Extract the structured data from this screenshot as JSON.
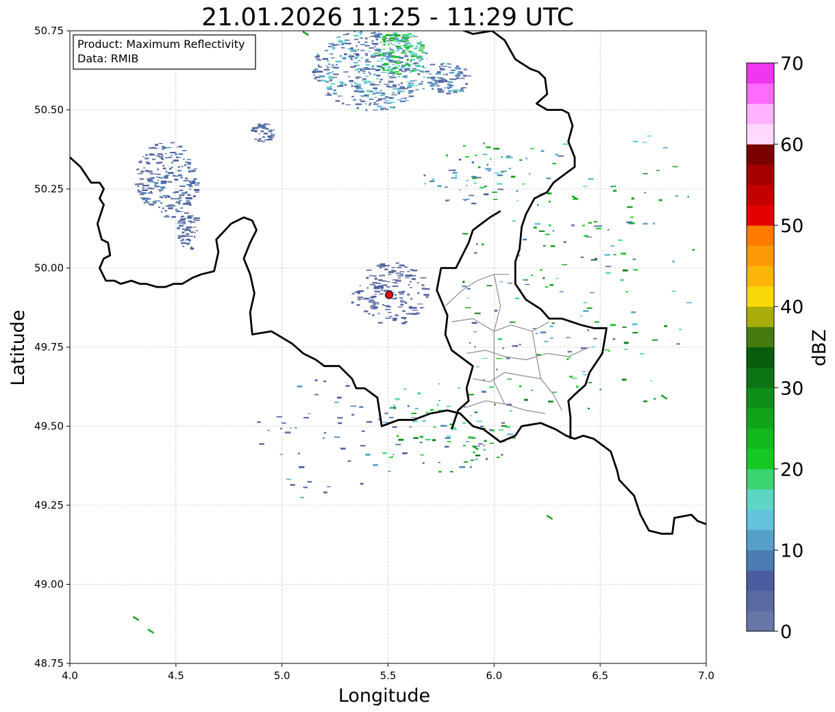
{
  "title": "21.01.2026 11:25 - 11:29 UTC",
  "info_box": {
    "product_line": "Product: Maximum Reflectivity",
    "data_line": "Data: RMIB"
  },
  "axes": {
    "xlabel": "Longitude",
    "ylabel": "Latitude",
    "xlim": [
      4.0,
      7.0
    ],
    "ylim": [
      48.75,
      50.75
    ],
    "xticks": [
      "4.0",
      "4.5",
      "5.0",
      "5.5",
      "6.0",
      "6.5",
      "7.0"
    ],
    "yticks": [
      "48.75",
      "49.00",
      "49.25",
      "49.50",
      "49.75",
      "50.00",
      "50.25",
      "50.50",
      "50.75"
    ],
    "grid": true
  },
  "colorbar": {
    "label": "dBZ",
    "range": [
      0,
      70
    ],
    "ticks": [
      "0",
      "10",
      "20",
      "30",
      "40",
      "50",
      "60",
      "70"
    ],
    "colors": [
      "#6877a8",
      "#5969a2",
      "#4a5da0",
      "#4a7bb2",
      "#55a0c8",
      "#63c2dc",
      "#5ed6c4",
      "#3ad471",
      "#14c922",
      "#13b81c",
      "#11a41a",
      "#0f8e17",
      "#0c7414",
      "#075c0e",
      "#477a0e",
      "#a9ad0c",
      "#fbd808",
      "#fcb609",
      "#fd9a09",
      "#ff7c03",
      "#e50000",
      "#c40000",
      "#a50000",
      "#7a0000",
      "#ffd9fd",
      "#ffb2fd",
      "#ff6bfb",
      "#f036ef"
    ]
  },
  "radar_site": {
    "lon": 5.505,
    "lat": 49.915,
    "color": "#e01010"
  },
  "chart_data": {
    "type": "map",
    "title": "21.01.2026 11:25 - 11:29 UTC",
    "xlabel": "Longitude",
    "ylabel": "Latitude",
    "xlim": [
      4.0,
      7.0
    ],
    "ylim": [
      48.75,
      50.75
    ],
    "grid": true,
    "borders": [
      [
        [
          4.0,
          50.35
        ],
        [
          4.05,
          50.32
        ],
        [
          4.1,
          50.27
        ],
        [
          4.14,
          50.27
        ],
        [
          4.16,
          50.25
        ],
        [
          4.14,
          50.22
        ],
        [
          4.16,
          50.2
        ],
        [
          4.13,
          50.14
        ],
        [
          4.15,
          50.09
        ],
        [
          4.18,
          50.08
        ],
        [
          4.19,
          50.04
        ],
        [
          4.16,
          50.03
        ],
        [
          4.14,
          50.0
        ],
        [
          4.17,
          49.96
        ],
        [
          4.21,
          49.96
        ],
        [
          4.24,
          49.95
        ],
        [
          4.29,
          49.96
        ],
        [
          4.33,
          49.95
        ],
        [
          4.36,
          49.95
        ],
        [
          4.41,
          49.94
        ],
        [
          4.45,
          49.94
        ],
        [
          4.49,
          49.95
        ],
        [
          4.53,
          49.95
        ],
        [
          4.58,
          49.97
        ],
        [
          4.62,
          49.98
        ],
        [
          4.68,
          49.99
        ],
        [
          4.7,
          50.05
        ],
        [
          4.69,
          50.09
        ],
        [
          4.76,
          50.14
        ],
        [
          4.82,
          50.16
        ],
        [
          4.86,
          50.15
        ],
        [
          4.88,
          50.12
        ],
        [
          4.85,
          50.08
        ],
        [
          4.82,
          50.03
        ],
        [
          4.85,
          49.98
        ],
        [
          4.87,
          49.92
        ],
        [
          4.85,
          49.86
        ],
        [
          4.86,
          49.79
        ],
        [
          4.95,
          49.8
        ],
        [
          5.0,
          49.78
        ],
        [
          5.05,
          49.76
        ],
        [
          5.1,
          49.73
        ],
        [
          5.16,
          49.71
        ],
        [
          5.2,
          49.69
        ],
        [
          5.27,
          49.69
        ],
        [
          5.33,
          49.65
        ],
        [
          5.35,
          49.62
        ],
        [
          5.39,
          49.62
        ],
        [
          5.45,
          49.59
        ],
        [
          5.47,
          49.5
        ],
        [
          5.55,
          49.52
        ],
        [
          5.62,
          49.52
        ],
        [
          5.7,
          49.54
        ],
        [
          5.78,
          49.55
        ],
        [
          5.84,
          49.54
        ],
        [
          5.9,
          49.5
        ],
        [
          5.95,
          49.49
        ],
        [
          6.03,
          49.45
        ],
        [
          6.1,
          49.47
        ],
        [
          6.13,
          49.5
        ],
        [
          6.22,
          49.51
        ],
        [
          6.29,
          49.49
        ],
        [
          6.34,
          49.47
        ],
        [
          6.38,
          49.46
        ],
        [
          6.42,
          49.47
        ],
        [
          6.47,
          49.46
        ],
        [
          6.55,
          49.42
        ],
        [
          6.58,
          49.36
        ],
        [
          6.59,
          49.33
        ],
        [
          6.66,
          49.28
        ],
        [
          6.69,
          49.22
        ],
        [
          6.73,
          49.17
        ],
        [
          6.79,
          49.16
        ],
        [
          6.84,
          49.16
        ],
        [
          6.85,
          49.21
        ],
        [
          6.93,
          49.22
        ],
        [
          6.96,
          49.2
        ],
        [
          7.0,
          49.19
        ]
      ],
      [
        [
          5.82,
          50.76
        ],
        [
          5.9,
          50.74
        ],
        [
          5.99,
          50.75
        ],
        [
          6.05,
          50.72
        ],
        [
          6.1,
          50.66
        ],
        [
          6.17,
          50.63
        ],
        [
          6.21,
          50.62
        ],
        [
          6.24,
          50.6
        ],
        [
          6.25,
          50.55
        ],
        [
          6.2,
          50.52
        ],
        [
          6.25,
          50.5
        ],
        [
          6.32,
          50.5
        ],
        [
          6.35,
          50.49
        ],
        [
          6.37,
          50.45
        ],
        [
          6.35,
          50.4
        ],
        [
          6.38,
          50.35
        ],
        [
          6.38,
          50.32
        ],
        [
          6.34,
          50.3
        ],
        [
          6.28,
          50.27
        ],
        [
          6.25,
          50.24
        ],
        [
          6.19,
          50.22
        ],
        [
          6.15,
          50.17
        ],
        [
          6.13,
          50.13
        ],
        [
          6.12,
          50.06
        ],
        [
          6.1,
          50.02
        ],
        [
          6.1,
          49.95
        ],
        [
          6.15,
          49.9
        ],
        [
          6.22,
          49.87
        ],
        [
          6.26,
          49.84
        ],
        [
          6.32,
          49.84
        ],
        [
          6.41,
          49.82
        ],
        [
          6.47,
          49.81
        ],
        [
          6.53,
          49.81
        ],
        [
          6.51,
          49.73
        ],
        [
          6.45,
          49.67
        ],
        [
          6.43,
          49.63
        ],
        [
          6.38,
          49.6
        ],
        [
          6.35,
          49.58
        ],
        [
          6.36,
          49.53
        ],
        [
          6.36,
          49.46
        ]
      ],
      [
        [
          6.03,
          50.18
        ],
        [
          5.98,
          50.16
        ],
        [
          5.9,
          50.12
        ],
        [
          5.88,
          50.08
        ],
        [
          5.82,
          50.0
        ],
        [
          5.75,
          50.0
        ],
        [
          5.73,
          49.93
        ],
        [
          5.78,
          49.85
        ],
        [
          5.77,
          49.79
        ],
        [
          5.8,
          49.74
        ],
        [
          5.86,
          49.71
        ],
        [
          5.9,
          49.69
        ],
        [
          5.87,
          49.62
        ],
        [
          5.88,
          49.58
        ],
        [
          5.83,
          49.55
        ],
        [
          5.8,
          49.49
        ]
      ]
    ],
    "radar_site": [
      5.505,
      49.915
    ]
  }
}
